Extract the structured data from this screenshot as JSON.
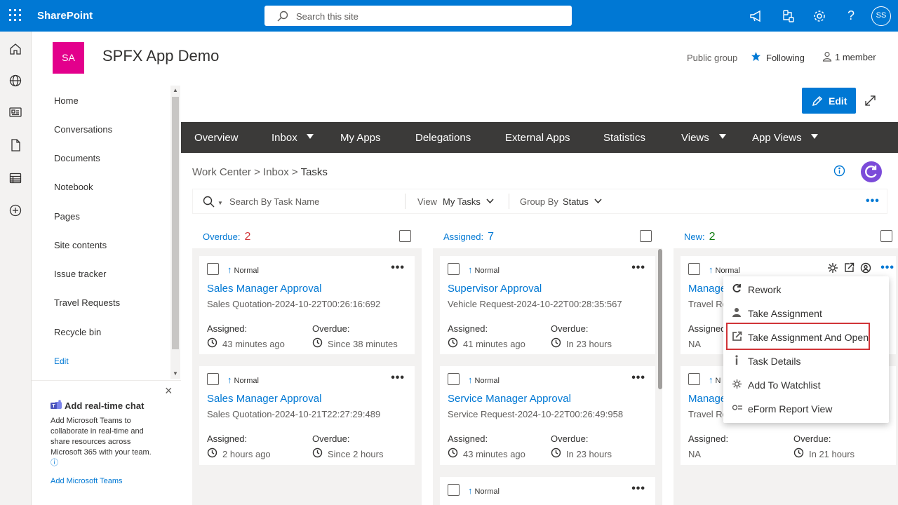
{
  "topbar": {
    "brand": "SharePoint",
    "search_placeholder": "Search this site",
    "avatar_initials": "SS",
    "icons": [
      "megaphone-icon",
      "share-icon",
      "gear-icon",
      "help-icon"
    ],
    "color": "#0078d4"
  },
  "appbar": {
    "icons": [
      "home-icon",
      "globe-icon",
      "news-icon",
      "document-icon",
      "list-icon",
      "add-icon"
    ]
  },
  "site": {
    "logo_initials": "SA",
    "title": "SPFX App Demo",
    "public_group": "Public group",
    "following": "Following",
    "members": "1 member",
    "logo_color": "#e3008c"
  },
  "leftnav": {
    "items": [
      "Home",
      "Conversations",
      "Documents",
      "Notebook",
      "Pages",
      "Site contents",
      "Issue tracker",
      "Travel Requests",
      "Recycle bin"
    ],
    "edit": "Edit"
  },
  "teams": {
    "title": "Add real-time chat",
    "description": "Add Microsoft Teams to collaborate in real-time and share resources across Microsoft 365 with your team.",
    "link": "Add Microsoft Teams"
  },
  "editbar": {
    "edit_label": "Edit"
  },
  "tabs": [
    {
      "label": "Overview",
      "dropdown": false
    },
    {
      "label": "Inbox",
      "dropdown": true
    },
    {
      "label": "My Apps",
      "dropdown": false
    },
    {
      "label": "Delegations",
      "dropdown": false
    },
    {
      "label": "External Apps",
      "dropdown": false
    },
    {
      "label": "Statistics",
      "dropdown": false
    },
    {
      "label": "Views",
      "dropdown": true
    },
    {
      "label": "App Views",
      "dropdown": true
    }
  ],
  "breadcrumb": {
    "items": [
      "Work Center",
      "Inbox",
      "Tasks"
    ],
    "separator": ">"
  },
  "filter": {
    "search_placeholder": "Search By Task Name",
    "view_label": "View",
    "view_value": "My Tasks",
    "group_label": "Group By",
    "group_value": "Status"
  },
  "columns": [
    {
      "title": "Overdue:",
      "count": "2",
      "count_color": "#d13438",
      "cards": [
        {
          "priority": "Normal",
          "title": "Sales Manager Approval",
          "subtitle": "Sales Quotation-2024-10-22T00:26:16:692",
          "assigned_label": "Assigned:",
          "assigned": "43 minutes ago",
          "overdue_label": "Overdue:",
          "overdue": "Since 38 minutes"
        },
        {
          "priority": "Normal",
          "title": "Sales Manager Approval",
          "subtitle": "Sales Quotation-2024-10-21T22:27:29:489",
          "assigned_label": "Assigned:",
          "assigned": "2 hours ago",
          "overdue_label": "Overdue:",
          "overdue": "Since 2 hours"
        }
      ]
    },
    {
      "title": "Assigned:",
      "count": "7",
      "count_color": "#0078d4",
      "cards": [
        {
          "priority": "Normal",
          "title": "Supervisor Approval",
          "subtitle": "Vehicle Request-2024-10-22T00:28:35:567",
          "assigned_label": "Assigned:",
          "assigned": "41 minutes ago",
          "overdue_label": "Overdue:",
          "overdue": "In 23 hours"
        },
        {
          "priority": "Normal",
          "title": "Service Manager Approval",
          "subtitle": "Service Request-2024-10-22T00:26:49:958",
          "assigned_label": "Assigned:",
          "assigned": "43 minutes ago",
          "overdue_label": "Overdue:",
          "overdue": "In 23 hours"
        },
        {
          "priority": "Normal"
        }
      ]
    },
    {
      "title": "New:",
      "count": "2",
      "count_color": "#107c10",
      "cards": [
        {
          "priority": "Normal",
          "title": "Manage",
          "subtitle": "Travel Re",
          "assigned_label": "Assigned:",
          "assigned": "NA"
        },
        {
          "priority": "N",
          "title": "Manage",
          "subtitle": "Travel Re",
          "assigned_label": "Assigned:",
          "assigned": "NA",
          "overdue_label": "Overdue:",
          "overdue": "In 21 hours"
        }
      ]
    }
  ],
  "context_menu": {
    "items": [
      {
        "label": "Rework",
        "icon": "rework-icon"
      },
      {
        "label": "Take Assignment",
        "icon": "person-icon"
      },
      {
        "label": "Take Assignment And Open",
        "icon": "open-external-icon"
      },
      {
        "label": "Task Details",
        "icon": "info-icon"
      },
      {
        "label": "Add To Watchlist",
        "icon": "watchlist-icon"
      },
      {
        "label": "eForm Report View",
        "icon": "report-icon"
      }
    ],
    "highlighted_index": 2,
    "highlight_color": "#d13438"
  }
}
